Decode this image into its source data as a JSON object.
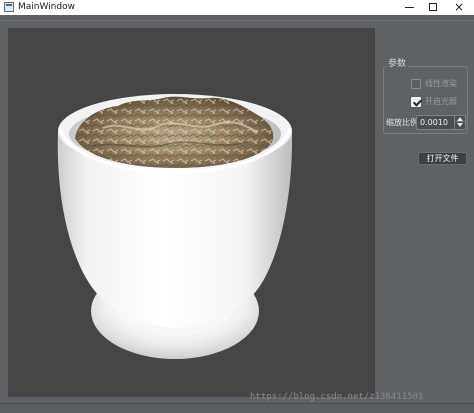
{
  "window": {
    "title": "MainWindow",
    "icon": "app-window-icon",
    "controls": {
      "minimize": "minimize-icon",
      "maximize": "maximize-icon",
      "close": "×"
    }
  },
  "params": {
    "group_title": "参数",
    "linear_render": {
      "label": "线性渲染",
      "checked": false
    },
    "lighting": {
      "label": "开启光照",
      "checked": true
    },
    "scale_label": "缩放比例",
    "scale_value": "0.0010",
    "open_file": "打开文件"
  },
  "viewport": {
    "background": "#464646",
    "subject": "white cup filled with textured material"
  },
  "watermark": "https://blog.csdn.net/z136411501"
}
